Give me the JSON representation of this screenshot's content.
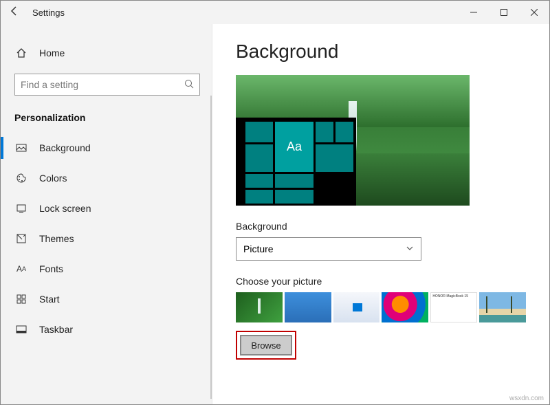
{
  "titlebar": {
    "title": "Settings"
  },
  "sidebar": {
    "home": "Home",
    "search_placeholder": "Find a setting",
    "category": "Personalization",
    "items": [
      {
        "label": "Background",
        "icon": "picture-icon",
        "active": true
      },
      {
        "label": "Colors",
        "icon": "palette-icon",
        "active": false
      },
      {
        "label": "Lock screen",
        "icon": "lockscreen-icon",
        "active": false
      },
      {
        "label": "Themes",
        "icon": "themes-icon",
        "active": false
      },
      {
        "label": "Fonts",
        "icon": "fonts-icon",
        "active": false
      },
      {
        "label": "Start",
        "icon": "start-icon",
        "active": false
      },
      {
        "label": "Taskbar",
        "icon": "taskbar-icon",
        "active": false
      }
    ]
  },
  "main": {
    "title": "Background",
    "preview_sample_text": "Aa",
    "bg_field_label": "Background",
    "bg_dropdown_value": "Picture",
    "choose_label": "Choose your picture",
    "thumbs": [
      {
        "name": "waterfall-green"
      },
      {
        "name": "solid-blue"
      },
      {
        "name": "windows-light"
      },
      {
        "name": "umbrellas"
      },
      {
        "name": "magicbook-ad",
        "text": "HONOR MagicBook 15"
      },
      {
        "name": "beach"
      }
    ],
    "browse_label": "Browse"
  },
  "watermark": "wsxdn.com"
}
